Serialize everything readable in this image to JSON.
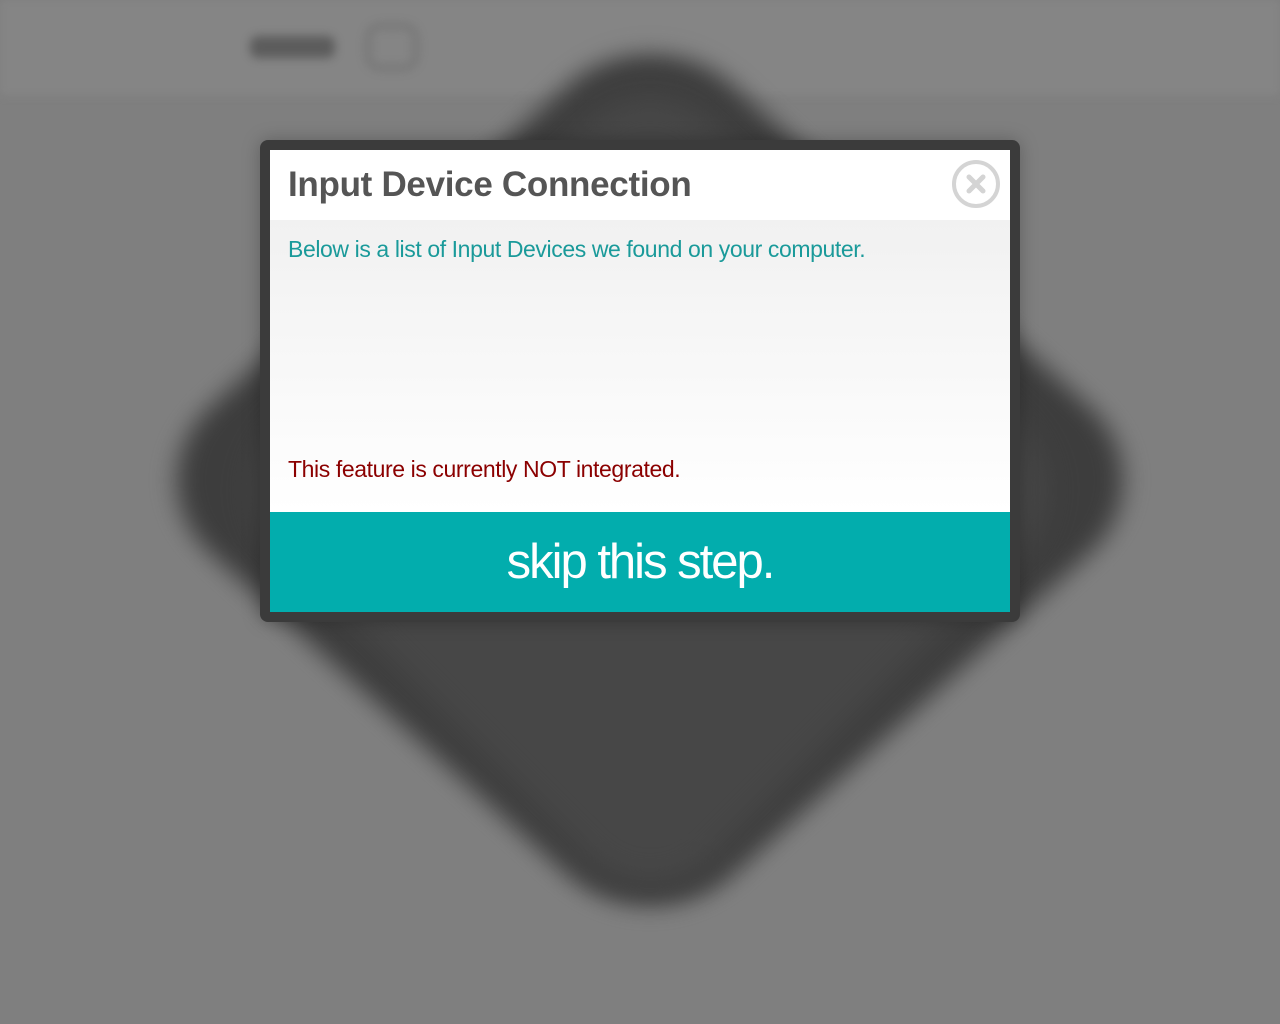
{
  "modal": {
    "title": "Input Device Connection",
    "intro": "Below is a list of Input Devices we found on your computer.",
    "devices": [],
    "warning": "This feature is currently NOT integrated.",
    "skip_label": "skip this step.",
    "close_icon": "close-icon"
  },
  "colors": {
    "accent": "#02adad",
    "intro_text": "#1a9a9a",
    "warning_text": "#8b0000",
    "title_text": "#555555"
  }
}
